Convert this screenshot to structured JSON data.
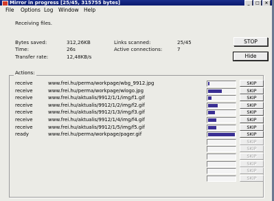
{
  "window": {
    "title": "Mirror in progress [25/45, 315755 bytes]",
    "controls": [
      "_",
      "□",
      "×"
    ]
  },
  "menu": [
    "File",
    "Options",
    "Log",
    "Window",
    "Help"
  ],
  "status": "Receiving files.",
  "stats": {
    "bytes_saved_label": "Bytes saved:",
    "bytes_saved": "312,26KB",
    "time_label": "Time:",
    "time": "26s",
    "rate_label": "Transfer rate:",
    "rate": "12,48KB/s",
    "links_label": "Links scanned:",
    "links": "25/45",
    "connections_label": "Active connections:",
    "connections": "7"
  },
  "buttons": {
    "stop": "STOP",
    "hide": "Hide"
  },
  "actions_label": "Actions:",
  "skip_label": "SKIP",
  "rows": [
    {
      "action": "receive",
      "url": "www.frei.hu/perma/workpage/wbg_9912.jpg",
      "progress": 0.05
    },
    {
      "action": "receive",
      "url": "www.frei.hu/perma/workpage/wlogo.jpg",
      "progress": 0.5
    },
    {
      "action": "receive",
      "url": "www.frei.hu/aktualis/9912/1/1/img/f1.gif",
      "progress": 0.12
    },
    {
      "action": "receive",
      "url": "www.frei.hu/aktualis/9912/1/2/img/f2.gif",
      "progress": 0.35
    },
    {
      "action": "receive",
      "url": "www.frei.hu/aktualis/9912/1/3/img/f3.gif",
      "progress": 0.25
    },
    {
      "action": "receive",
      "url": "www.frei.hu/aktualis/9912/1/4/img/f4.gif",
      "progress": 0.3
    },
    {
      "action": "receive",
      "url": "www.frei.hu/aktualis/9912/1/5/img/f5.gif",
      "progress": 0.3
    },
    {
      "action": "ready",
      "url": "www.frei.hu/perma/workpage/pager.gif",
      "progress": 1.0
    },
    {
      "action": "",
      "url": "",
      "progress": 0
    },
    {
      "action": "",
      "url": "",
      "progress": 0
    },
    {
      "action": "",
      "url": "",
      "progress": 0
    },
    {
      "action": "",
      "url": "",
      "progress": 0
    },
    {
      "action": "",
      "url": "",
      "progress": 0
    },
    {
      "action": "",
      "url": "",
      "progress": 0
    }
  ]
}
